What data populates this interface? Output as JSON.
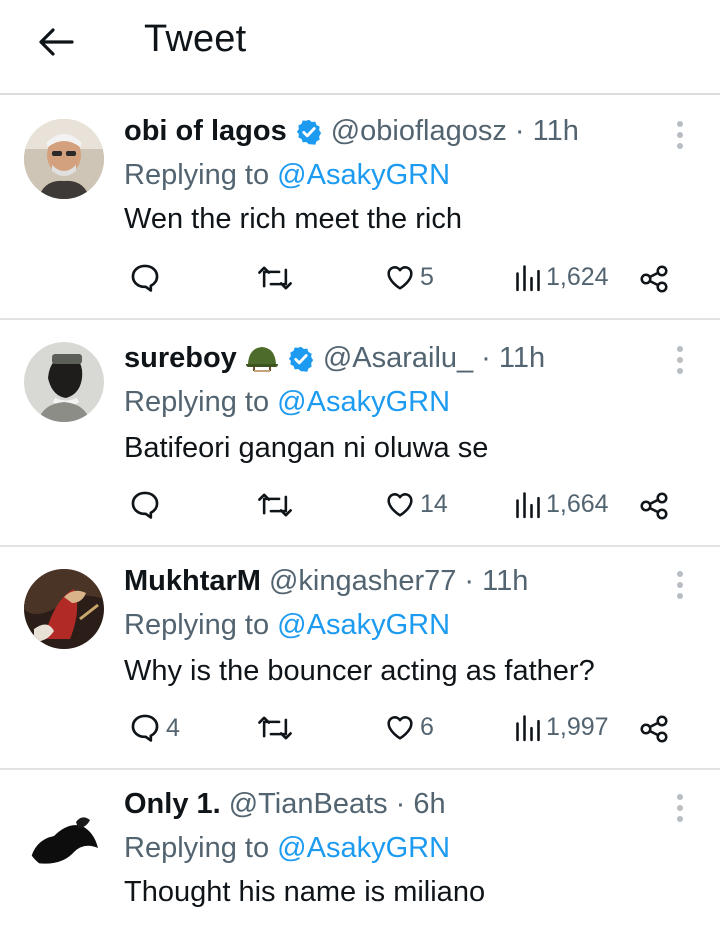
{
  "header": {
    "title": "Tweet"
  },
  "replies": [
    {
      "display_name": "obi of lagos",
      "verified": true,
      "handle": "@obioflagosz",
      "time": "· 11h",
      "replying_label": "Replying to",
      "replying_to": "@AsakyGRN",
      "text": "Wen the rich meet the rich",
      "comments": "",
      "retweets": "",
      "likes": "5",
      "views": "1,624"
    },
    {
      "display_name": "sureboy",
      "emoji": "military-helmet-icon",
      "verified": true,
      "handle": "@Asarailu_",
      "time": "· 11h",
      "replying_label": "Replying to",
      "replying_to": "@AsakyGRN",
      "text": "Batifeori gangan ni oluwa se",
      "comments": "",
      "retweets": "",
      "likes": "14",
      "views": "1,664"
    },
    {
      "display_name": "MukhtarM",
      "verified": false,
      "handle": "@kingasher77",
      "time": "· 11h",
      "replying_label": "Replying to",
      "replying_to": "@AsakyGRN",
      "text": "Why is the bouncer acting as father?",
      "comments": "4",
      "retweets": "",
      "likes": "6",
      "views": "1,997"
    },
    {
      "display_name": "Only 1.",
      "verified": false,
      "handle": "@TianBeats",
      "time": "· 6h",
      "replying_label": "Replying to",
      "replying_to": "@AsakyGRN",
      "text": "Thought his name is miliano"
    }
  ],
  "colors": {
    "verified": "#1d9bf0",
    "mention": "#1d9bf0",
    "secondary_text": "#536471",
    "primary_text": "#0f1419"
  }
}
